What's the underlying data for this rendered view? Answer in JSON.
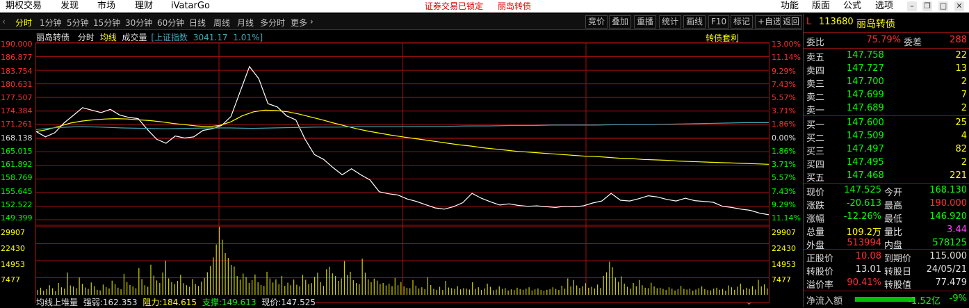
{
  "menu": {
    "items": [
      "期权交易",
      "发现",
      "市场",
      "理财",
      "iVatarGo"
    ],
    "status": "证券交易已锁定",
    "stock_name": "丽岛转债",
    "right_items": [
      "功能",
      "版面",
      "公式",
      "选项"
    ]
  },
  "toolbar": {
    "periods": [
      "分时",
      "1分钟",
      "5分钟",
      "15分钟",
      "30分钟",
      "60分钟",
      "日线",
      "周线",
      "月线",
      "多分时",
      "更多"
    ],
    "more_arrow": "›",
    "right_buttons": [
      "竞价",
      "叠加",
      "重播",
      "统计",
      "画线",
      "F10",
      "标记",
      "+自选",
      "返回"
    ]
  },
  "chart_header": {
    "name": "丽岛转债",
    "mode": "分时",
    "avg": "均线",
    "volume": "成交量",
    "index_label": "[上证指数",
    "index_value": "3041.17",
    "index_pct": "1.01%]",
    "strategy": "转债套利"
  },
  "axes": {
    "price_ticks": [
      "190.000",
      "186.877",
      "183.754",
      "180.631",
      "177.507",
      "174.384",
      "171.261",
      "168.138",
      "165.015",
      "161.892",
      "158.769",
      "155.645",
      "152.522",
      "149.399"
    ],
    "pct_ticks": [
      "13.00%",
      "11.14%",
      "9.29%",
      "7.43%",
      "5.57%",
      "3.71%",
      "1.86%",
      "0.00%",
      "1.86%",
      "3.71%",
      "5.57%",
      "7.43%",
      "9.29%",
      "11.14%"
    ],
    "vol_ticks": [
      "29907",
      "22430",
      "14953",
      "7477"
    ]
  },
  "footer": {
    "label": "均线上堆量",
    "strength_label": "强弱:",
    "strength": "162.353",
    "resist_label": "阻力:",
    "resist": "184.615",
    "support_label": "支撑:",
    "support": "149.613",
    "price_label": "现价:",
    "price": "147.525"
  },
  "chart_data": {
    "type": "line",
    "prev_close": 168.138,
    "ylim": [
      146.9,
      190.0
    ],
    "series": [
      {
        "values": [
          168.1,
          166.8,
          167.8,
          170.2,
          172.1,
          174.0,
          173.4,
          172.8,
          173.6,
          172.2,
          171.6,
          171.3,
          168.6,
          166.2,
          165.2,
          167.0,
          166.5,
          166.8,
          168.4,
          168.8,
          169.6,
          171.8,
          178.0,
          184.2,
          181.2,
          175.0,
          174.2,
          172.0,
          171.0,
          166.2,
          162.4,
          161.2,
          159.2,
          157.4,
          158.9,
          157.4,
          156.1,
          153.2,
          152.7,
          152.4,
          151.4,
          150.8,
          150.0,
          149.2,
          148.9,
          149.5,
          150.5,
          152.8,
          151.6,
          150.7,
          149.9,
          150.2,
          149.8,
          149.6,
          149.7,
          149.5,
          149.3,
          149.6,
          149.5,
          149.7,
          150.4,
          150.9,
          152.8,
          151.1,
          150.9,
          151.5,
          152.2,
          151.9,
          151.3,
          150.9,
          151.6,
          151.0,
          150.8,
          150.6,
          149.6,
          149.3,
          148.9,
          148.6,
          147.9,
          147.5
        ]
      },
      {
        "values": [
          168.1,
          168.6,
          169.4,
          170.2,
          170.7,
          171.0,
          171.2,
          171.3,
          171.2,
          171.0,
          170.8,
          170.5,
          170.1,
          169.8,
          169.5,
          169.3,
          169.6,
          170.5,
          172.0,
          173.0,
          173.4,
          173.3,
          173.0,
          172.4,
          171.7,
          171.0,
          170.2,
          169.5,
          168.8,
          168.2,
          167.7,
          167.2,
          166.8,
          166.4,
          166.0,
          165.6,
          165.2,
          164.8,
          164.5,
          164.1,
          163.8,
          163.5,
          163.2,
          163.0,
          162.8,
          162.6,
          162.4,
          162.2,
          162.0,
          161.9,
          161.7,
          161.5,
          161.4,
          161.2,
          161.1,
          161.0,
          160.8,
          160.7,
          160.6,
          160.5,
          160.4,
          160.3,
          160.2,
          160.1,
          160.0
        ]
      },
      {
        "values": [
          168.6,
          169.1,
          169.3,
          169.2,
          169.0,
          168.9,
          168.8,
          168.9,
          169.0,
          169.0,
          168.9,
          169.0,
          169.1,
          169.2,
          169.2,
          169.3,
          169.3,
          169.3,
          169.4,
          169.4,
          169.5,
          169.5,
          169.6,
          169.6,
          169.7,
          169.7,
          169.7,
          169.8,
          169.8,
          169.9,
          170.0,
          170.1,
          170.2,
          170.3,
          170.3
        ]
      }
    ],
    "volume": [
      2100,
      3100,
      1800,
      2500,
      4200,
      2900,
      1600,
      5200,
      3300,
      2700,
      9800,
      4100,
      3600,
      2900,
      7600,
      4800,
      3200,
      2600,
      5400,
      3800,
      2200,
      1900,
      4500,
      3400,
      2800,
      6200,
      4700,
      3100,
      2400,
      9200,
      5600,
      4300,
      3700,
      2900,
      11800,
      6900,
      4200,
      3500,
      13200,
      8400,
      6300,
      5200,
      9800,
      14900,
      7200,
      5600,
      4700,
      6100,
      8800,
      5100,
      4200,
      3500,
      6900,
      4700,
      3900,
      5800,
      7400,
      9900,
      12600,
      16400,
      22100,
      29800,
      24200,
      18300,
      16200,
      13100,
      12400,
      8200,
      6700,
      9300,
      7800,
      5200,
      6400,
      8900,
      5500,
      4300,
      3900,
      10100,
      7200,
      5400,
      6800,
      4700,
      8300,
      3900,
      5300,
      4200,
      6700,
      4400,
      3700,
      8800,
      6600,
      4700,
      5100,
      7900,
      9700,
      5600,
      3900,
      11200,
      12300,
      9400,
      8200,
      6100,
      7200,
      14800,
      8700,
      10100,
      6400,
      5200,
      4700,
      15900,
      9700,
      6800,
      5500,
      7100,
      6200,
      4700,
      5200,
      4100,
      4900,
      3800,
      7400,
      4200,
      5600,
      3700,
      3100,
      2900,
      6500,
      4000,
      2800,
      3300,
      2500,
      7700,
      4300,
      2600,
      2200,
      3500,
      2100,
      6100,
      3200,
      2900,
      2600,
      3800,
      2400,
      2900,
      2700,
      2300,
      5500,
      2600,
      3300,
      2100,
      2800,
      4900,
      3500,
      2000,
      2300,
      3700,
      2600,
      2900,
      1900,
      2400,
      2100,
      3100,
      2500,
      2200,
      2700,
      3300,
      1900,
      2400,
      2800,
      2100,
      1800,
      2200,
      2500,
      3300,
      2600,
      2100,
      4000,
      2700,
      7200,
      3700,
      6500,
      4100,
      3000,
      3800,
      5100,
      3100,
      3500,
      2800,
      4500,
      3000,
      8300,
      9900,
      14500,
      12100,
      7600,
      5700,
      8100,
      4900,
      3500,
      2700,
      5200,
      3800,
      6500,
      4200,
      3100,
      2900,
      5300,
      3700,
      2900,
      3100,
      2600,
      2100,
      3300,
      2700,
      1900,
      2500,
      3900,
      2600,
      2300,
      2700,
      1800,
      2300,
      2900,
      3700,
      2500,
      2100,
      1900,
      2700,
      3100,
      2200,
      2600,
      1800,
      4100,
      3300,
      2200,
      3600,
      4900,
      2300,
      3100,
      2600,
      3800,
      2300,
      6600,
      3700,
      4600,
      2800
    ]
  },
  "order_book": {
    "code_prefix": "L",
    "code": "113680",
    "name": "丽岛转债",
    "weibi_label": "委比",
    "weibi": "75.79%",
    "weicha_label": "委差",
    "weicha": "288",
    "asks": [
      {
        "label": "卖五",
        "price": "147.758",
        "vol": "22"
      },
      {
        "label": "卖四",
        "price": "147.727",
        "vol": "13"
      },
      {
        "label": "卖三",
        "price": "147.700",
        "vol": "2"
      },
      {
        "label": "卖二",
        "price": "147.699",
        "vol": "7"
      },
      {
        "label": "卖一",
        "price": "147.689",
        "vol": "2"
      }
    ],
    "bids": [
      {
        "label": "买一",
        "price": "147.600",
        "vol": "25"
      },
      {
        "label": "买二",
        "price": "147.509",
        "vol": "4"
      },
      {
        "label": "买三",
        "price": "147.497",
        "vol": "82"
      },
      {
        "label": "买四",
        "price": "147.495",
        "vol": "2"
      },
      {
        "label": "买五",
        "price": "147.468",
        "vol": "221"
      }
    ]
  },
  "quote": [
    {
      "l1": "现价",
      "v1": "147.525",
      "c1": "#00ff00",
      "l2": "今开",
      "v2": "168.130",
      "c2": "#00ff00"
    },
    {
      "l1": "涨跌",
      "v1": "-20.613",
      "c1": "#00ff00",
      "l2": "最高",
      "v2": "190.000",
      "c2": "#ff3030"
    },
    {
      "l1": "涨幅",
      "v1": "-12.26%",
      "c1": "#00ff00",
      "l2": "最低",
      "v2": "146.920",
      "c2": "#00ff00"
    },
    {
      "l1": "总量",
      "v1": "109.2万",
      "c1": "#ffff00",
      "l2": "量比",
      "v2": "3.44",
      "c2": "#ff40ff"
    },
    {
      "l1": "外盘",
      "v1": "513994",
      "c1": "#ff3030",
      "l2": "内盘",
      "v2": "578125",
      "c2": "#00ff00"
    }
  ],
  "bond": [
    {
      "l1": "正股价",
      "v1": "10.08",
      "c1": "#ff3030",
      "l2": "到期价",
      "v2": "115.000",
      "c2": "#e0e0e0"
    },
    {
      "l1": "转股价",
      "v1": "13.01",
      "c1": "#e0e0e0",
      "l2": "转股日",
      "v2": "24/05/21",
      "c2": "#e0e0e0"
    },
    {
      "l1": "溢价率",
      "v1": "90.41%",
      "c1": "#ff3030",
      "l2": "转股值",
      "v2": "77.479",
      "c2": "#e0e0e0"
    }
  ],
  "net_inflow": {
    "label": "净流入额",
    "value": "-1.52亿",
    "pct": "-9%"
  },
  "colors": {
    "up": "#ff3030",
    "down": "#00ff00",
    "grid": "#a01010",
    "price_line": "#ffffff",
    "avg_line": "#ffff00",
    "index_line": "#3ea8b8",
    "volume": "#d0d000"
  }
}
